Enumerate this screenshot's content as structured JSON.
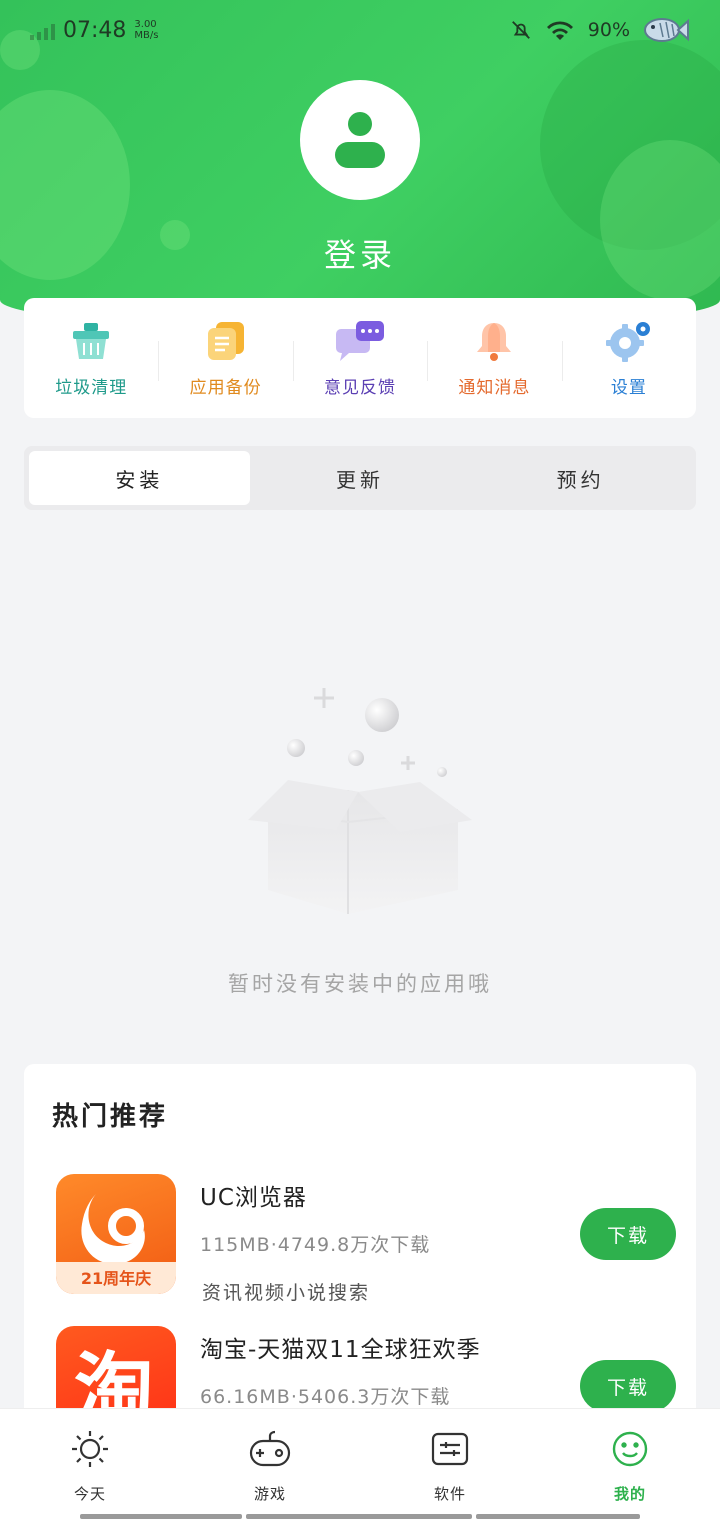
{
  "status_bar": {
    "time": "07:48",
    "speed_value": "3.00",
    "speed_unit": "MB/s",
    "battery": "90%"
  },
  "profile": {
    "login_label": "登录"
  },
  "quick_actions": [
    {
      "label": "垃圾清理",
      "color": "#1e9a8a",
      "icon": "trash-basket-icon"
    },
    {
      "label": "应用备份",
      "color": "#e08a1e",
      "icon": "backup-doc-icon"
    },
    {
      "label": "意见反馈",
      "color": "#5b3fb3",
      "icon": "chat-feedback-icon"
    },
    {
      "label": "通知消息",
      "color": "#e46a2e",
      "icon": "bell-icon"
    },
    {
      "label": "设置",
      "color": "#2a7fd4",
      "icon": "gear-icon"
    }
  ],
  "tabs": [
    {
      "label": "安装",
      "active": true
    },
    {
      "label": "更新",
      "active": false
    },
    {
      "label": "预约",
      "active": false
    }
  ],
  "empty_state": {
    "message": "暂时没有安装中的应用哦"
  },
  "hot": {
    "title": "热门推荐",
    "apps": [
      {
        "name": "UC浏览器",
        "meta": "115MB·4749.8万次下载",
        "desc": "资讯视频小说搜索",
        "button": "下载",
        "icon_badge": "21周年庆"
      },
      {
        "name": "淘宝-天猫双11全球狂欢季",
        "meta": "66.16MB·5406.3万次下载",
        "desc": "",
        "button": "下载",
        "icon_badge": "淘"
      }
    ]
  },
  "bottom_nav": [
    {
      "label": "今天",
      "icon": "sun-icon"
    },
    {
      "label": "游戏",
      "icon": "gamepad-icon"
    },
    {
      "label": "软件",
      "icon": "software-icon"
    },
    {
      "label": "我的",
      "icon": "smiley-icon",
      "active": true
    }
  ],
  "colors": {
    "brand_green": "#2eb14d",
    "header_green": "#3fcf62"
  }
}
